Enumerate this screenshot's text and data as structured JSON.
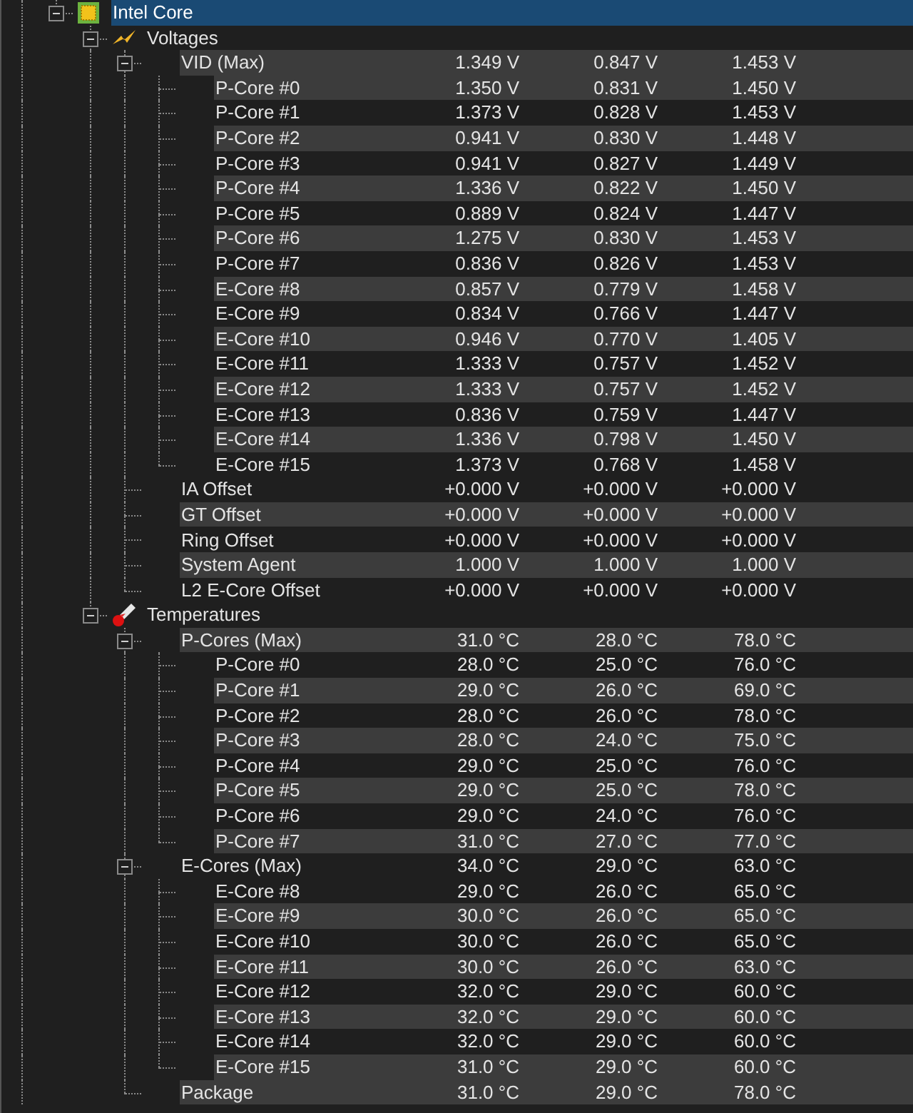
{
  "tree": [
    {
      "label": "Intel Core",
      "kind": "device",
      "expanded": true,
      "selected": true,
      "children": [
        {
          "label": "Voltages",
          "kind": "voltage-group",
          "expanded": true,
          "selected": false,
          "shaded": false,
          "children": [
            {
              "label": "VID (Max)",
              "kind": "sensor",
              "expanded": true,
              "selected": false,
              "shaded": true,
              "values": [
                "1.349 V",
                "0.847 V",
                "1.453 V"
              ],
              "children": [
                {
                  "label": "P-Core #0",
                  "kind": "sensor",
                  "selected": false,
                  "shaded": true,
                  "values": [
                    "1.350 V",
                    "0.831 V",
                    "1.450 V"
                  ]
                },
                {
                  "label": "P-Core #1",
                  "kind": "sensor",
                  "selected": false,
                  "shaded": false,
                  "values": [
                    "1.373 V",
                    "0.828 V",
                    "1.453 V"
                  ]
                },
                {
                  "label": "P-Core #2",
                  "kind": "sensor",
                  "selected": false,
                  "shaded": true,
                  "values": [
                    "0.941 V",
                    "0.830 V",
                    "1.448 V"
                  ]
                },
                {
                  "label": "P-Core #3",
                  "kind": "sensor",
                  "selected": false,
                  "shaded": false,
                  "values": [
                    "0.941 V",
                    "0.827 V",
                    "1.449 V"
                  ]
                },
                {
                  "label": "P-Core #4",
                  "kind": "sensor",
                  "selected": false,
                  "shaded": true,
                  "values": [
                    "1.336 V",
                    "0.822 V",
                    "1.450 V"
                  ]
                },
                {
                  "label": "P-Core #5",
                  "kind": "sensor",
                  "selected": false,
                  "shaded": false,
                  "values": [
                    "0.889 V",
                    "0.824 V",
                    "1.447 V"
                  ]
                },
                {
                  "label": "P-Core #6",
                  "kind": "sensor",
                  "selected": false,
                  "shaded": true,
                  "values": [
                    "1.275 V",
                    "0.830 V",
                    "1.453 V"
                  ]
                },
                {
                  "label": "P-Core #7",
                  "kind": "sensor",
                  "selected": false,
                  "shaded": false,
                  "values": [
                    "0.836 V",
                    "0.826 V",
                    "1.453 V"
                  ]
                },
                {
                  "label": "E-Core #8",
                  "kind": "sensor",
                  "selected": false,
                  "shaded": true,
                  "values": [
                    "0.857 V",
                    "0.779 V",
                    "1.458 V"
                  ]
                },
                {
                  "label": "E-Core #9",
                  "kind": "sensor",
                  "selected": false,
                  "shaded": false,
                  "values": [
                    "0.834 V",
                    "0.766 V",
                    "1.447 V"
                  ]
                },
                {
                  "label": "E-Core #10",
                  "kind": "sensor",
                  "selected": false,
                  "shaded": true,
                  "values": [
                    "0.946 V",
                    "0.770 V",
                    "1.405 V"
                  ]
                },
                {
                  "label": "E-Core #11",
                  "kind": "sensor",
                  "selected": false,
                  "shaded": false,
                  "values": [
                    "1.333 V",
                    "0.757 V",
                    "1.452 V"
                  ]
                },
                {
                  "label": "E-Core #12",
                  "kind": "sensor",
                  "selected": false,
                  "shaded": true,
                  "values": [
                    "1.333 V",
                    "0.757 V",
                    "1.452 V"
                  ]
                },
                {
                  "label": "E-Core #13",
                  "kind": "sensor",
                  "selected": false,
                  "shaded": false,
                  "values": [
                    "0.836 V",
                    "0.759 V",
                    "1.447 V"
                  ]
                },
                {
                  "label": "E-Core #14",
                  "kind": "sensor",
                  "selected": false,
                  "shaded": true,
                  "values": [
                    "1.336 V",
                    "0.798 V",
                    "1.450 V"
                  ]
                },
                {
                  "label": "E-Core #15",
                  "kind": "sensor",
                  "selected": false,
                  "shaded": false,
                  "values": [
                    "1.373 V",
                    "0.768 V",
                    "1.458 V"
                  ]
                }
              ]
            },
            {
              "label": "IA Offset",
              "kind": "sensor",
              "selected": false,
              "shaded": false,
              "values": [
                "+0.000 V",
                "+0.000 V",
                "+0.000 V"
              ]
            },
            {
              "label": "GT Offset",
              "kind": "sensor",
              "selected": false,
              "shaded": true,
              "values": [
                "+0.000 V",
                "+0.000 V",
                "+0.000 V"
              ]
            },
            {
              "label": "Ring Offset",
              "kind": "sensor",
              "selected": false,
              "shaded": false,
              "values": [
                "+0.000 V",
                "+0.000 V",
                "+0.000 V"
              ]
            },
            {
              "label": "System Agent",
              "kind": "sensor",
              "selected": false,
              "shaded": true,
              "values": [
                "1.000 V",
                "1.000 V",
                "1.000 V"
              ]
            },
            {
              "label": "L2 E-Core Offset",
              "kind": "sensor",
              "selected": false,
              "shaded": false,
              "values": [
                "+0.000 V",
                "+0.000 V",
                "+0.000 V"
              ]
            }
          ]
        },
        {
          "label": "Temperatures",
          "kind": "temperature-group",
          "expanded": true,
          "selected": false,
          "shaded": false,
          "children": [
            {
              "label": "P-Cores (Max)",
              "kind": "sensor",
              "expanded": true,
              "selected": false,
              "shaded": true,
              "values": [
                "31.0 °C",
                "28.0 °C",
                "78.0 °C"
              ],
              "children": [
                {
                  "label": "P-Core #0",
                  "kind": "sensor",
                  "selected": false,
                  "shaded": false,
                  "values": [
                    "28.0 °C",
                    "25.0 °C",
                    "76.0 °C"
                  ]
                },
                {
                  "label": "P-Core #1",
                  "kind": "sensor",
                  "selected": false,
                  "shaded": true,
                  "values": [
                    "29.0 °C",
                    "26.0 °C",
                    "69.0 °C"
                  ]
                },
                {
                  "label": "P-Core #2",
                  "kind": "sensor",
                  "selected": false,
                  "shaded": false,
                  "values": [
                    "28.0 °C",
                    "26.0 °C",
                    "78.0 °C"
                  ]
                },
                {
                  "label": "P-Core #3",
                  "kind": "sensor",
                  "selected": false,
                  "shaded": true,
                  "values": [
                    "28.0 °C",
                    "24.0 °C",
                    "75.0 °C"
                  ]
                },
                {
                  "label": "P-Core #4",
                  "kind": "sensor",
                  "selected": false,
                  "shaded": false,
                  "values": [
                    "29.0 °C",
                    "25.0 °C",
                    "76.0 °C"
                  ]
                },
                {
                  "label": "P-Core #5",
                  "kind": "sensor",
                  "selected": false,
                  "shaded": true,
                  "values": [
                    "29.0 °C",
                    "25.0 °C",
                    "78.0 °C"
                  ]
                },
                {
                  "label": "P-Core #6",
                  "kind": "sensor",
                  "selected": false,
                  "shaded": false,
                  "values": [
                    "29.0 °C",
                    "24.0 °C",
                    "76.0 °C"
                  ]
                },
                {
                  "label": "P-Core #7",
                  "kind": "sensor",
                  "selected": false,
                  "shaded": true,
                  "values": [
                    "31.0 °C",
                    "27.0 °C",
                    "77.0 °C"
                  ]
                }
              ]
            },
            {
              "label": "E-Cores (Max)",
              "kind": "sensor",
              "expanded": true,
              "selected": false,
              "shaded": false,
              "values": [
                "34.0 °C",
                "29.0 °C",
                "63.0 °C"
              ],
              "children": [
                {
                  "label": "E-Core #8",
                  "kind": "sensor",
                  "selected": false,
                  "shaded": false,
                  "values": [
                    "29.0 °C",
                    "26.0 °C",
                    "65.0 °C"
                  ]
                },
                {
                  "label": "E-Core #9",
                  "kind": "sensor",
                  "selected": false,
                  "shaded": true,
                  "values": [
                    "30.0 °C",
                    "26.0 °C",
                    "65.0 °C"
                  ]
                },
                {
                  "label": "E-Core #10",
                  "kind": "sensor",
                  "selected": false,
                  "shaded": false,
                  "values": [
                    "30.0 °C",
                    "26.0 °C",
                    "65.0 °C"
                  ]
                },
                {
                  "label": "E-Core #11",
                  "kind": "sensor",
                  "selected": false,
                  "shaded": true,
                  "values": [
                    "30.0 °C",
                    "26.0 °C",
                    "63.0 °C"
                  ]
                },
                {
                  "label": "E-Core #12",
                  "kind": "sensor",
                  "selected": false,
                  "shaded": false,
                  "values": [
                    "32.0 °C",
                    "29.0 °C",
                    "60.0 °C"
                  ]
                },
                {
                  "label": "E-Core #13",
                  "kind": "sensor",
                  "selected": false,
                  "shaded": true,
                  "values": [
                    "32.0 °C",
                    "29.0 °C",
                    "60.0 °C"
                  ]
                },
                {
                  "label": "E-Core #14",
                  "kind": "sensor",
                  "selected": false,
                  "shaded": false,
                  "values": [
                    "32.0 °C",
                    "29.0 °C",
                    "60.0 °C"
                  ]
                },
                {
                  "label": "E-Core #15",
                  "kind": "sensor",
                  "selected": false,
                  "shaded": true,
                  "values": [
                    "31.0 °C",
                    "29.0 °C",
                    "60.0 °C"
                  ]
                }
              ]
            },
            {
              "label": "Package",
              "kind": "sensor",
              "selected": false,
              "shaded": true,
              "values": [
                "31.0 °C",
                "29.0 °C",
                "78.0 °C"
              ]
            }
          ]
        }
      ]
    }
  ]
}
